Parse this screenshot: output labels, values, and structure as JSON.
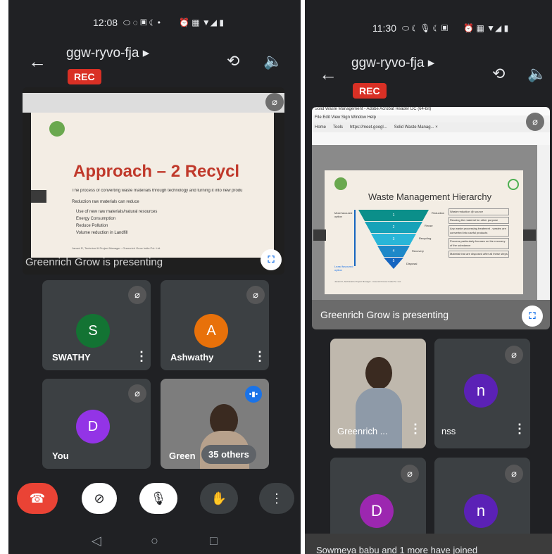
{
  "left": {
    "status": {
      "time": "12:08",
      "icons": "⬭ ◌ ▣ ☾ •",
      "right_icons": "⏰ ▦ ▼◢ ▮"
    },
    "meeting_code": "ggw-ryvo-fja ▸",
    "rec_label": "REC",
    "presentation": {
      "slide_title": "Approach – 2 Recycl",
      "slide_intro": "The process of converting waste materials through technology and turning it into new produ",
      "slide_subhead": "Reduction raw materials can reduce",
      "bullets": [
        "Use of new raw materials/natural resources",
        "Energy Consumption",
        "Reduce Pollution",
        "Volume reduction in Landfill"
      ],
      "footer": "Janani R, Technical & Project Manager - Greenrich Grow India Pvt. Ltd.",
      "banner": "Greenrich Grow is presenting"
    },
    "tiles": [
      {
        "initial": "S",
        "name": "SWATHY",
        "color": "#137333"
      },
      {
        "initial": "A",
        "name": "Ashwathy",
        "color": "#e8710a"
      },
      {
        "initial": "D",
        "name": "You",
        "color": "#9334e6"
      }
    ],
    "video_tile": {
      "name": "Green",
      "others": "35 others"
    },
    "controls": {
      "end": "☎",
      "camera": "⊘",
      "mic": "🎙",
      "hand": "✋",
      "more": "⋮"
    },
    "nav": {
      "back": "◁",
      "home": "○",
      "recent": "□"
    }
  },
  "right": {
    "status": {
      "time": "11:30",
      "icons": "⬭ ☾ 🎙 ☾ ▣",
      "right_icons": "⏰ ▦ ▼◢ ▮"
    },
    "meeting_code": "ggw-ryvo-fja ▸",
    "rec_label": "REC",
    "presentation": {
      "window_title": "Solid Waste Management - Adobe Acrobat Reader DC (64-bit)",
      "menu": "File  Edit  View  Sign  Window  Help",
      "tabs": [
        "Home",
        "Tools",
        "https://meet.googl...",
        "Solid Waste Manag... ×"
      ],
      "slide_title": "Waste Management Hierarchy",
      "left_axis_top": "Most favoured option",
      "left_axis_bottom": "Least favoured option",
      "levels": [
        {
          "num": "1",
          "label": "Reduction",
          "desc": "Waste reduction @ source"
        },
        {
          "num": "2",
          "label": "Reuse",
          "desc": "Reusing the material for other purpose"
        },
        {
          "num": "3",
          "label": "Recycling",
          "desc": "Any waste processing treatment - wastes are converted into useful products"
        },
        {
          "num": "4",
          "label": "Recovery",
          "desc": "Process particularly focuses on the recovery of the substance"
        },
        {
          "num": "5",
          "label": "Disposal",
          "desc": "Material that are disposed after all these steps"
        }
      ],
      "footer": "Janani R, Technical & Project Manager - Greenrich Grow India Pvt. Ltd.",
      "banner": "Greenrich Grow is presenting"
    },
    "tiles": [
      {
        "name": "Greenrich ..."
      },
      {
        "initial": "n",
        "name": "nss",
        "color": "#5b21b6"
      },
      {
        "initial": "D",
        "color": "#9c27b0"
      },
      {
        "initial": "n",
        "color": "#5b21b6"
      }
    ],
    "toast": "Sowmeya babu and 1 more have joined"
  }
}
